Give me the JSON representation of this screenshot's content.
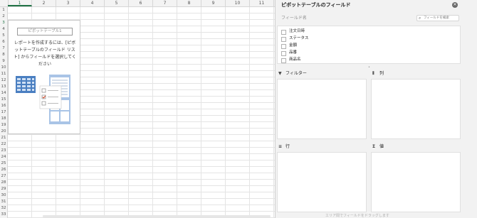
{
  "sheet": {
    "columns": [
      "1",
      "2",
      "3",
      "4",
      "5",
      "6",
      "7",
      "8",
      "9",
      "10",
      "11"
    ],
    "rows": [
      "1",
      "2",
      "3",
      "4",
      "5",
      "6",
      "7",
      "8",
      "9",
      "10",
      "11",
      "12",
      "13",
      "14",
      "15",
      "16",
      "17",
      "18",
      "19",
      "20",
      "21",
      "22",
      "23",
      "24",
      "25",
      "26",
      "27",
      "28",
      "29",
      "30",
      "31",
      "32",
      "33"
    ],
    "selected_column": "1",
    "selected_row": "3"
  },
  "pivot_placeholder": {
    "name": "ピボットテーブル1",
    "message": "レポートを作成するには、[ピボットテーブルのフィールド リスト] からフィールドを選択してください",
    "illustration_icon": "pivot-table-illustration"
  },
  "panel": {
    "title": "ピボットテーブルのフィールド",
    "close_icon": "close-icon",
    "field_name_label": "フィールド名",
    "search_placeholder": "フィールドを検索",
    "fields": [
      "注文日時",
      "ステータス",
      "金額",
      "品番",
      "商品名"
    ],
    "areas": {
      "filter": {
        "label": "フィルター",
        "icon": "filter-icon"
      },
      "columns": {
        "label": "列",
        "icon": "columns-icon"
      },
      "rows": {
        "label": "行",
        "icon": "rows-icon"
      },
      "values": {
        "label": "値",
        "icon": "sigma-icon"
      }
    },
    "hint": "エリア間でフィールドをドラッグします"
  }
}
